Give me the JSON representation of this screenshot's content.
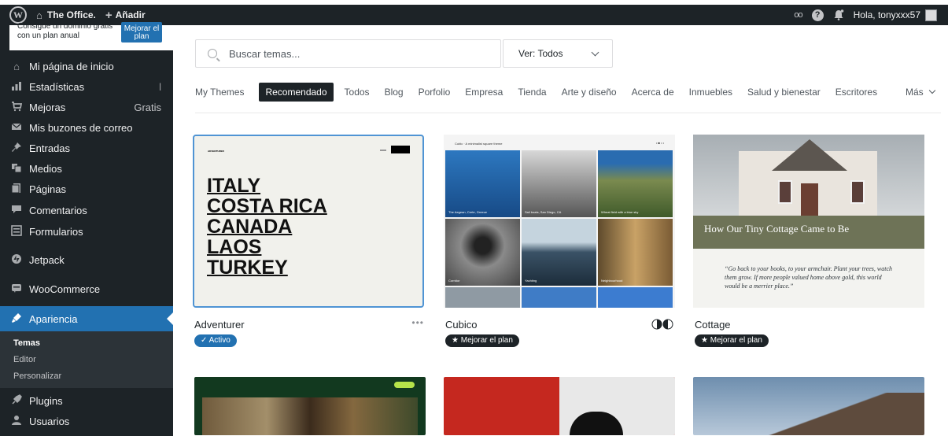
{
  "admin_bar": {
    "site_name": "The Office.",
    "add_new": "Añadir",
    "reader_icon": "oo",
    "greeting": "Hola, tonyxxx57"
  },
  "promo": {
    "text": "Consigue un dominio gratis con un plan anual",
    "button": "Mejorar el plan"
  },
  "sidebar": {
    "items": [
      {
        "label": "Mi página de inicio",
        "icon": "home-icon"
      },
      {
        "label": "Estadísticas",
        "icon": "stats-icon"
      },
      {
        "label": "Mejoras",
        "icon": "cart-icon",
        "right": "Gratis"
      },
      {
        "label": "Mis buzones de correo",
        "icon": "mail-icon"
      },
      {
        "label": "Entradas",
        "icon": "pin-icon"
      },
      {
        "label": "Medios",
        "icon": "media-icon"
      },
      {
        "label": "Páginas",
        "icon": "pages-icon"
      },
      {
        "label": "Comentarios",
        "icon": "comments-icon"
      },
      {
        "label": "Formularios",
        "icon": "forms-icon"
      },
      {
        "label": "Jetpack",
        "icon": "jetpack-icon"
      },
      {
        "label": "WooCommerce",
        "icon": "woocommerce-icon"
      },
      {
        "label": "Apariencia",
        "icon": "appearance-icon"
      },
      {
        "label": "Plugins",
        "icon": "plugins-icon"
      },
      {
        "label": "Usuarios",
        "icon": "users-icon"
      }
    ],
    "submenu": [
      "Temas",
      "Editor",
      "Personalizar"
    ]
  },
  "search": {
    "placeholder": "Buscar temas..."
  },
  "filter": {
    "selected": "Ver: Todos"
  },
  "tabs": [
    "My Themes",
    "Recomendado",
    "Todos",
    "Blog",
    "Porfolio",
    "Empresa",
    "Tienda",
    "Arte y diseño",
    "Acerca de",
    "Inmuebles",
    "Salud y bienestar",
    "Escritores",
    "Más"
  ],
  "active_tab": "Recomendado",
  "themes": [
    {
      "name": "Adventurer",
      "badge": "✓ Activo",
      "preview_lines": [
        "ITALY",
        "COSTA RICA",
        "CANADA",
        "LAOS",
        "TURKEY"
      ],
      "preview_brand": "ADVENTURER"
    },
    {
      "name": "Cubico",
      "badge": "★ Mejorar el plan",
      "preview_header": "Cubic · A minimalist square theme",
      "captions": [
        "The Aegean, Crete, Greece",
        "Sail boats, San Diego, CA",
        "Wheat field with a blue sky",
        "Corridor",
        "Yachting",
        "Neighbourhood"
      ]
    },
    {
      "name": "Cottage",
      "badge": "★ Mejorar el plan",
      "preview_title": "How Our Tiny Cottage Came to Be",
      "preview_quote": "“Go back to your books, to your armchair. Plant your trees, watch them grow. If more people valued home above gold, this world would be a merrier place.”"
    }
  ],
  "colors": {
    "admin_bg": "#1d2327",
    "accent": "#2271b1",
    "sub_bg": "#2c3338"
  }
}
